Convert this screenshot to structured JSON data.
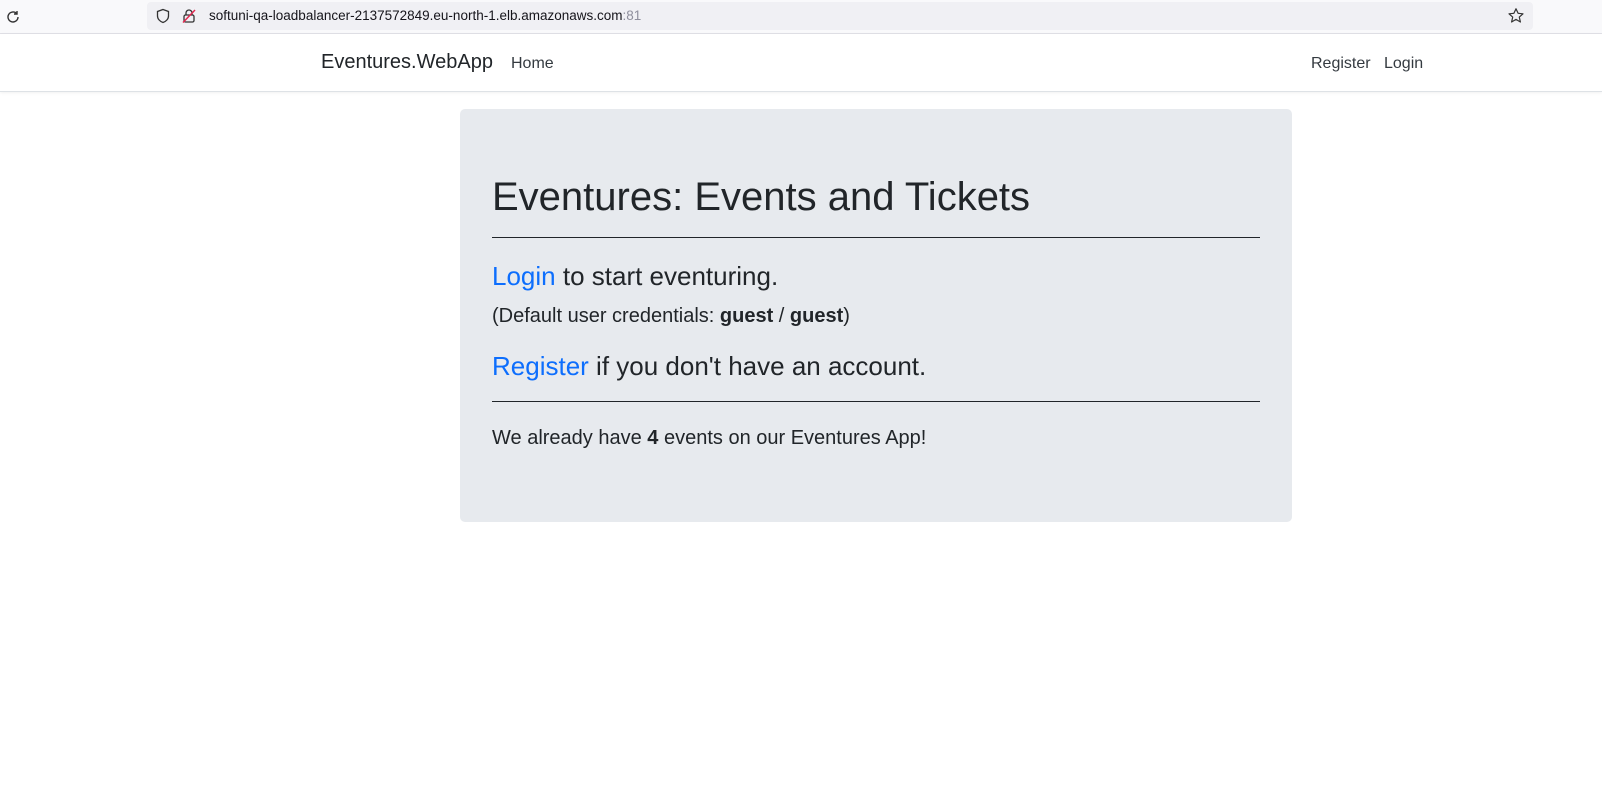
{
  "browser": {
    "url_host": "softuni-qa-loadbalancer-2137572849.eu-north-1.elb.amazonaws.com",
    "url_port": ":81",
    "icons": [
      "reload-icon",
      "shield-icon",
      "lock-icon",
      "star-icon"
    ]
  },
  "navbar": {
    "brand": "Eventures.WebApp",
    "home": "Home",
    "register": "Register",
    "login": "Login"
  },
  "main": {
    "title": "Eventures: Events and Tickets",
    "login_link": "Login",
    "login_text": " to start eventuring.",
    "creds_prefix": "(Default user credentials: ",
    "creds_user": "guest",
    "creds_sep": " / ",
    "creds_pass": "guest",
    "creds_suffix": ")",
    "register_link": "Register",
    "register_text": " if you don't have an account.",
    "events_prefix": "We already have ",
    "events_count": "4",
    "events_suffix": " events on our Eventures App!"
  },
  "colors": {
    "link": "#0d6efd",
    "jumbotron_bg": "#e7eaee",
    "text": "#212529"
  }
}
